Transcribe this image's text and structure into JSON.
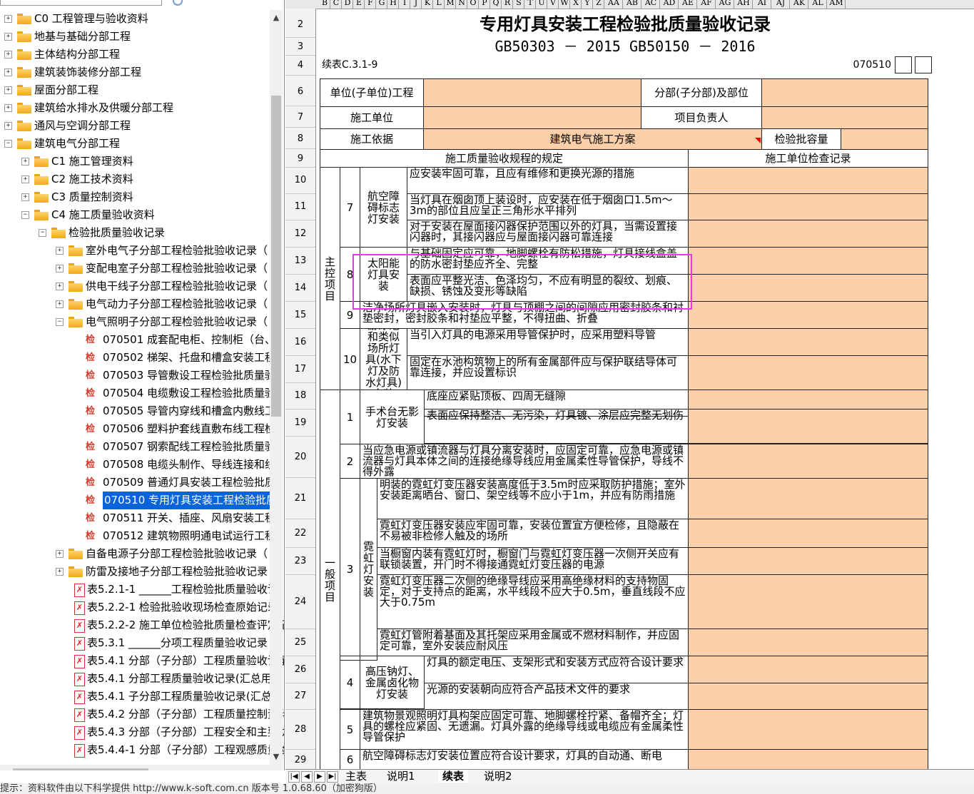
{
  "tree": {
    "items": [
      {
        "label": "C0 工程管理与验收资料",
        "level": 0,
        "exp": "+",
        "icon": "folder"
      },
      {
        "label": "地基与基础分部工程",
        "level": 0,
        "exp": "+",
        "icon": "folder"
      },
      {
        "label": "主体结构分部工程",
        "level": 0,
        "exp": "+",
        "icon": "folder"
      },
      {
        "label": "建筑装饰装修分部工程",
        "level": 0,
        "exp": "+",
        "icon": "folder"
      },
      {
        "label": "屋面分部工程",
        "level": 0,
        "exp": "+",
        "icon": "folder"
      },
      {
        "label": "建筑给水排水及供暖分部工程",
        "level": 0,
        "exp": "+",
        "icon": "folder"
      },
      {
        "label": "通风与空调分部工程",
        "level": 0,
        "exp": "+",
        "icon": "folder"
      },
      {
        "label": "建筑电气分部工程",
        "level": 0,
        "exp": "-",
        "icon": "folder"
      },
      {
        "label": "C1 施工管理资料",
        "level": 1,
        "exp": "+",
        "icon": "folder"
      },
      {
        "label": "C2 施工技术资料",
        "level": 1,
        "exp": "+",
        "icon": "folder"
      },
      {
        "label": "C3 质量控制资料",
        "level": 1,
        "exp": "+",
        "icon": "folder"
      },
      {
        "label": "C4 施工质量验收资料",
        "level": 1,
        "exp": "-",
        "icon": "folder"
      },
      {
        "label": "检验批质量验收记录",
        "level": 2,
        "exp": "-",
        "icon": "folder"
      },
      {
        "label": "室外电气子分部工程检验批验收记录（",
        "level": 3,
        "exp": "+",
        "icon": "folder"
      },
      {
        "label": "变配电室子分部工程检验批验收记录（",
        "level": 3,
        "exp": "+",
        "icon": "folder"
      },
      {
        "label": "供电干线子分部工程检验批验收记录（",
        "level": 3,
        "exp": "+",
        "icon": "folder"
      },
      {
        "label": "电气动力子分部工程检验批验收记录（",
        "level": 3,
        "exp": "+",
        "icon": "folder"
      },
      {
        "label": "电气照明子分部工程检验批验收记录（",
        "level": 3,
        "exp": "-",
        "icon": "folder"
      },
      {
        "label": "070501 成套配电柜、控制柜（台、",
        "level": 4,
        "exp": "",
        "icon": "jian"
      },
      {
        "label": "070502 梯架、托盘和槽盒安装工程",
        "level": 4,
        "exp": "",
        "icon": "jian"
      },
      {
        "label": "070503 导管敷设工程检验批质量验",
        "level": 4,
        "exp": "",
        "icon": "jian"
      },
      {
        "label": "070504 电缆敷设工程检验批质量验",
        "level": 4,
        "exp": "",
        "icon": "jian"
      },
      {
        "label": "070505 导管内穿线和槽盒内敷线工",
        "level": 4,
        "exp": "",
        "icon": "jian"
      },
      {
        "label": "070506 塑料护套线直敷布线工程检",
        "level": 4,
        "exp": "",
        "icon": "jian"
      },
      {
        "label": "070507 钢索配线工程检验批质量验",
        "level": 4,
        "exp": "",
        "icon": "jian"
      },
      {
        "label": "070508 电缆头制作、导线连接和线",
        "level": 4,
        "exp": "",
        "icon": "jian"
      },
      {
        "label": "070509 普通灯具安装工程检验批质",
        "level": 4,
        "exp": "",
        "icon": "jian"
      },
      {
        "label": "070510 专用灯具安装工程检验批质",
        "level": 4,
        "exp": "",
        "icon": "jian",
        "selected": true
      },
      {
        "label": "070511 开关、插座、风扇安装工程",
        "level": 4,
        "exp": "",
        "icon": "jian"
      },
      {
        "label": "070512 建筑物照明通电试运行工程",
        "level": 4,
        "exp": "",
        "icon": "jian"
      },
      {
        "label": "自备电源子分部工程检验批验收记录（",
        "level": 3,
        "exp": "+",
        "icon": "folder"
      },
      {
        "label": "防雷及接地子分部工程检验批验收记录",
        "level": 3,
        "exp": "+",
        "icon": "folder"
      },
      {
        "label": "表5.2.1-1 ______工程检验批质量验收记",
        "level": 1,
        "exp": "",
        "icon": "pdf"
      },
      {
        "label": "表5.2.2-1 检验批验收现场检查原始记录",
        "level": 1,
        "exp": "",
        "icon": "pdf"
      },
      {
        "label": "表5.2.2-2 施工单位检验批质量检查评定记",
        "level": 1,
        "exp": "",
        "icon": "pdf"
      },
      {
        "label": "表5.3.1 ______分项工程质量验收记录",
        "level": 1,
        "exp": "",
        "icon": "pdf"
      },
      {
        "label": "表5.4.1 分部（子分部）工程质量验收记录",
        "level": 1,
        "exp": "",
        "icon": "pdf"
      },
      {
        "label": "表5.4.1 分部工程质量验收记录(汇总用)",
        "level": 1,
        "exp": "",
        "icon": "pdf"
      },
      {
        "label": "表5.4.1 子分部工程质量验收记录(汇总用",
        "level": 1,
        "exp": "",
        "icon": "pdf"
      },
      {
        "label": "表5.4.2 分部（子分部）工程质量控制资料",
        "level": 1,
        "exp": "",
        "icon": "pdf"
      },
      {
        "label": "表5.4.3 分部（子分部）工程安全和主要功",
        "level": 1,
        "exp": "",
        "icon": "pdf"
      },
      {
        "label": "表5.4.4-1 分部（子分部）工程观感质量检",
        "level": 1,
        "exp": "",
        "icon": "pdf"
      }
    ]
  },
  "columns": [
    "B",
    "C",
    "D",
    "E",
    "F",
    "G",
    "H",
    "I",
    "J",
    "K",
    "L",
    "M",
    "N",
    "O",
    "P",
    "Q",
    "R",
    "S",
    "T",
    "U",
    "V",
    "W",
    "X",
    "Y",
    "Z",
    "AA",
    "AB",
    "AC",
    "AD",
    "AE",
    "AF",
    "AG",
    "AH",
    "AI",
    "AJ",
    "AK",
    "AL",
    "AM"
  ],
  "rows": {
    "r2": "2",
    "r3": "3",
    "r4": "4",
    "r6": "6",
    "r7": "7",
    "r8": "8",
    "r9": "9",
    "r10": "10",
    "r11": "11",
    "r12": "12",
    "r13": "13",
    "r14": "14",
    "r15": "15",
    "r16": "16",
    "r17": "17",
    "r18": "18",
    "r19": "19",
    "r20": "20",
    "r21": "21",
    "r22": "22",
    "r23": "23",
    "r24": "24",
    "r25": "25",
    "r26": "26",
    "r27": "27",
    "r28": "28",
    "r29": "29"
  },
  "form": {
    "title": "专用灯具安装工程检验批质量验收记录",
    "standards": "GB50303 － 2015 GB50150 － 2016",
    "continued": "续表C.3.1-9",
    "code": "070510",
    "unit_project": "单位(子单位)工程",
    "sub_project": "分部(子分部)及部位",
    "contractor": "施工单位",
    "project_manager": "项目负责人",
    "basis": "施工依据",
    "basis_value": "建筑电气施工方案",
    "batch_capacity": "检验批容量",
    "spec_header": "施工质量验收规程的规定",
    "check_header": "施工单位检查记录",
    "main_items": "主控项目",
    "general_items": "一般项目"
  },
  "items": {
    "n7": "7",
    "g7": "航空障碍标志灯安装",
    "t10": "应安装牢固可靠，且应有维修和更换光源的措施",
    "t11": "当灯具在烟囱顶上装设时，应安装在低于烟囱口1.5m～3m的部位且应呈正三角形水平排列",
    "t12": "对于安装在屋面接闪器保护范围以外的灯具，当需设置接闪器时，其接闪器应与屋面接闪器可靠连接",
    "n8": "8",
    "g8": "太阳能灯具安装",
    "t13": "与基础固定应可靠，地脚螺栓有防松措施，灯具接线盒盖的防水密封垫应齐全、完整",
    "t14": "表面应平整光洁、色泽均匀，不应有明显的裂纹、划痕、缺损、锈蚀及变形等缺陷",
    "n9": "9",
    "t15": "洁净场所灯具嵌入安装时，灯具与顶棚之间的间隙应用密封胶条和衬垫密封，密封胶条和衬垫应平整，不得扭曲、折叠",
    "n10": "10",
    "g10": "游泳池和类似场所灯具(水下灯及防水灯具)安装",
    "t16": "当引入灯具的电源采用导管保护时，应采用塑料导管",
    "t17": "固定在水池构筑物上的所有金属部件应与保护联结导体可靠连接，并应设置标识",
    "n1": "1",
    "g1": "手术台无影灯安装",
    "t18": "底座应紧贴顶板、四周无缝隙",
    "t19": "表面应保持整洁、无污染，灯具镀、涂层应完整无划伤",
    "n2": "2",
    "t20": "当应急电源或镇流器与灯具分离安装时，应固定可靠，应急电源或镇流器与灯具本体之间的连接绝缘导线应用金属柔性导管保护，导线不得外露",
    "n3": "3",
    "g3": "霓虹灯安装",
    "t21": "明装的霓虹灯变压器安装高度低于3.5m时应采取防护措施；室外安装距离晒台、窗口、架空线等不应小于1m，并应有防雨措施",
    "t22": "霓虹灯变压器安装应牢固可靠，安装位置宜方便检修，且隐蔽在不易被非检修人触及的场所",
    "t23": "当橱窗内装有霓虹灯时，橱窗门与霓虹灯变压器一次侧开关应有联锁装置，开门时不得接通霓虹灯变压器的电源",
    "t24": "霓虹灯变压器二次侧的绝缘导线应采用高绝缘材料的支持物固定，对于支持点的距离，水平线段不应大于0.5m，垂直线段不应大于0.75m",
    "t25": "霓虹灯管附着基面及其托架应采用金属或不燃材料制作，并应固定可靠，室外安装应耐风压",
    "n4": "4",
    "g4": "高压钠灯、金属卤化物灯安装",
    "t26": "灯具的额定电压、支架形式和安装方式应符合设计要求",
    "t27": "光源的安装朝向应符合产品技术文件的要求",
    "n5": "5",
    "t28": "建筑物景观照明灯具构架应固定可靠、地脚螺栓拧紧、备帽齐全；灯具的螺栓应紧固、无遗漏。灯具外露的绝缘导线或电缆应有金属柔性导管保护",
    "n6": "6",
    "t29": "航空障碍标志灯安装位置应符合设计要求，灯具的自动通、断电"
  },
  "tabs": [
    "主表",
    "说明1",
    "续表",
    "说明2"
  ],
  "status": "提示：资料软件由以下科学提供    http://www.k-soft.com.cn    版本号 1.0.68.60（加密狗版）",
  "colors": {
    "peach": "#fbcfa8",
    "selection": "#e23de0",
    "tree_selected": "#0a64d8"
  }
}
